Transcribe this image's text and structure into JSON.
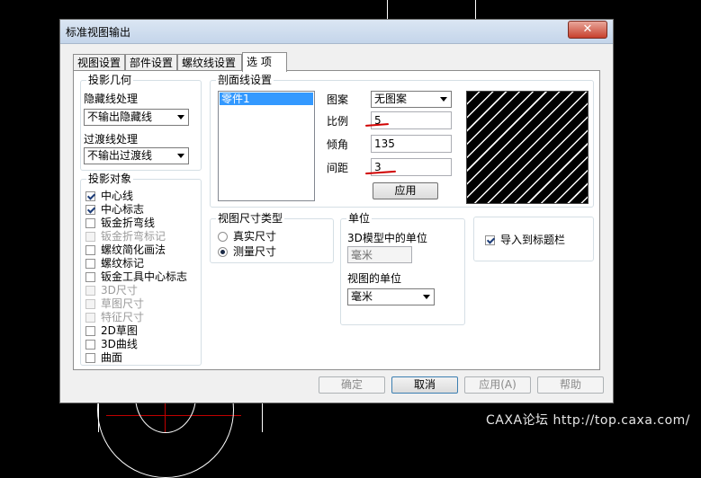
{
  "window": {
    "title": "标准视图输出",
    "close_glyph": "✕"
  },
  "tabs": [
    "视图设置",
    "部件设置",
    "螺纹线设置",
    "选 项"
  ],
  "projection_geometry": {
    "title": "投影几何",
    "hidden_label": "隐藏线处理",
    "hidden_value": "不输出隐藏线",
    "transition_label": "过渡线处理",
    "transition_value": "不输出过渡线"
  },
  "projection_objects": {
    "title": "投影对象",
    "items": [
      {
        "label": "中心线",
        "checked": true,
        "enabled": true
      },
      {
        "label": "中心标志",
        "checked": true,
        "enabled": true
      },
      {
        "label": "钣金折弯线",
        "checked": false,
        "enabled": true
      },
      {
        "label": "钣金折弯标记",
        "checked": false,
        "enabled": false
      },
      {
        "label": "螺纹简化画法",
        "checked": false,
        "enabled": true
      },
      {
        "label": "螺纹标记",
        "checked": false,
        "enabled": true
      },
      {
        "label": "钣金工具中心标志",
        "checked": false,
        "enabled": true
      },
      {
        "label": "3D尺寸",
        "checked": false,
        "enabled": false
      },
      {
        "label": "草图尺寸",
        "checked": false,
        "enabled": false
      },
      {
        "label": "特征尺寸",
        "checked": false,
        "enabled": false
      },
      {
        "label": "2D草图",
        "checked": false,
        "enabled": true
      },
      {
        "label": "3D曲线",
        "checked": false,
        "enabled": true
      },
      {
        "label": "曲面",
        "checked": false,
        "enabled": true
      }
    ]
  },
  "section_settings": {
    "title": "剖面线设置",
    "list_items": [
      "零件1"
    ],
    "pattern_label": "图案",
    "pattern_value": "无图案",
    "scale_label": "比例",
    "scale_value": "5",
    "angle_label": "倾角",
    "angle_value": "135",
    "spacing_label": "间距",
    "spacing_value": "3",
    "apply_label": "应用"
  },
  "view_dim_type": {
    "title": "视图尺寸类型",
    "options": [
      {
        "label": "真实尺寸",
        "selected": false
      },
      {
        "label": "测量尺寸",
        "selected": true
      }
    ]
  },
  "units": {
    "title": "单位",
    "model_unit_label": "3D模型中的单位",
    "model_unit_value": "毫米",
    "view_unit_label": "视图的单位",
    "view_unit_value": "毫米"
  },
  "import_title": {
    "label": "导入到标题栏",
    "checked": true
  },
  "footer": {
    "ok": "确定",
    "cancel": "取消",
    "apply": "应用(A)",
    "help": "帮助"
  },
  "watermark": "CAXA论坛 http://top.caxa.com/",
  "colors": {
    "hatch_bg": "#000000",
    "hatch_line": "#ffffff",
    "selection": "#3399ff",
    "annotation_red": "#d00000"
  }
}
